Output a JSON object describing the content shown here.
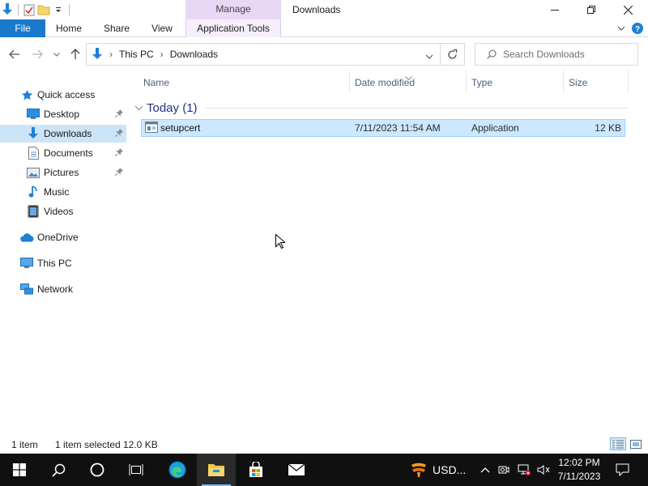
{
  "window": {
    "title": "Downloads",
    "contextual_tab": "Manage"
  },
  "ribbon": {
    "file": "File",
    "home": "Home",
    "share": "Share",
    "view": "View",
    "application_tools": "Application Tools"
  },
  "address": {
    "crumbs": [
      "This PC",
      "Downloads"
    ],
    "search_placeholder": "Search Downloads"
  },
  "nav": {
    "quick_access": "Quick access",
    "items": [
      {
        "label": "Desktop",
        "icon": "desktop-icon",
        "pinned": true
      },
      {
        "label": "Downloads",
        "icon": "downloads-icon",
        "pinned": true,
        "selected": true
      },
      {
        "label": "Documents",
        "icon": "documents-icon",
        "pinned": true
      },
      {
        "label": "Pictures",
        "icon": "pictures-icon",
        "pinned": true
      },
      {
        "label": "Music",
        "icon": "music-icon"
      },
      {
        "label": "Videos",
        "icon": "videos-icon"
      }
    ],
    "onedrive": "OneDrive",
    "this_pc": "This PC",
    "network": "Network"
  },
  "columns": {
    "name": "Name",
    "date_modified": "Date modified",
    "type": "Type",
    "size": "Size"
  },
  "group": {
    "label": "Today (1)"
  },
  "files": [
    {
      "name": "setupcert",
      "date_modified": "7/11/2023 11:54 AM",
      "type": "Application",
      "size": "12 KB",
      "selected": true
    }
  ],
  "status": {
    "count": "1 item",
    "selected": "1 item selected",
    "selected_size": "12.0 KB"
  },
  "taskbar": {
    "tray_label": "USD...",
    "time": "12:02 PM",
    "date": "7/11/2023"
  },
  "colors": {
    "accent": "#1979ca",
    "selection": "#cce8ff",
    "manage_tab": "#e8d8f5",
    "taskbar": "#101010"
  }
}
